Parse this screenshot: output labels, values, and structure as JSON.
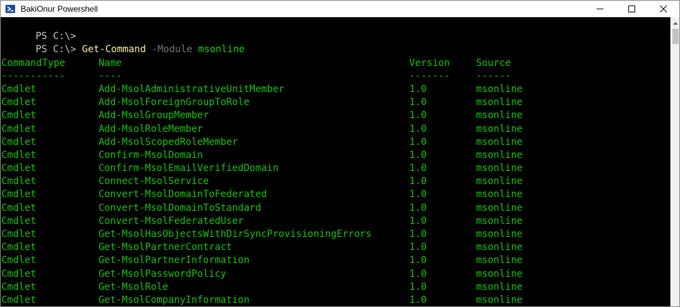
{
  "window": {
    "title": "BakiOnur Powershell"
  },
  "prompt_lines": [
    {
      "prompt": "PS C:\\>",
      "command": "",
      "param": "",
      "arg": ""
    },
    {
      "prompt": "PS C:\\>",
      "command": "Get-Command",
      "param": "-Module",
      "arg": "msonline"
    }
  ],
  "table": {
    "headers": [
      "CommandType",
      "Name",
      "Version",
      "Source"
    ],
    "separators": [
      "-----------",
      "----",
      "-------",
      "------"
    ],
    "rows": [
      [
        "Cmdlet",
        "Add-MsolAdministrativeUnitMember",
        "1.0",
        "msonline"
      ],
      [
        "Cmdlet",
        "Add-MsolForeignGroupToRole",
        "1.0",
        "msonline"
      ],
      [
        "Cmdlet",
        "Add-MsolGroupMember",
        "1.0",
        "msonline"
      ],
      [
        "Cmdlet",
        "Add-MsolRoleMember",
        "1.0",
        "msonline"
      ],
      [
        "Cmdlet",
        "Add-MsolScopedRoleMember",
        "1.0",
        "msonline"
      ],
      [
        "Cmdlet",
        "Confirm-MsolDomain",
        "1.0",
        "msonline"
      ],
      [
        "Cmdlet",
        "Confirm-MsolEmailVerifiedDomain",
        "1.0",
        "msonline"
      ],
      [
        "Cmdlet",
        "Connect-MsolService",
        "1.0",
        "msonline"
      ],
      [
        "Cmdlet",
        "Convert-MsolDomainToFederated",
        "1.0",
        "msonline"
      ],
      [
        "Cmdlet",
        "Convert-MsolDomainToStandard",
        "1.0",
        "msonline"
      ],
      [
        "Cmdlet",
        "Convert-MsolFederatedUser",
        "1.0",
        "msonline"
      ],
      [
        "Cmdlet",
        "Get-MsolHasObjectsWithDirSyncProvisioningErrors",
        "1.0",
        "msonline"
      ],
      [
        "Cmdlet",
        "Get-MsolPartnerContract",
        "1.0",
        "msonline"
      ],
      [
        "Cmdlet",
        "Get-MsolPartnerInformation",
        "1.0",
        "msonline"
      ],
      [
        "Cmdlet",
        "Get-MsolPasswordPolicy",
        "1.0",
        "msonline"
      ],
      [
        "Cmdlet",
        "Get-MsolRole",
        "1.0",
        "msonline"
      ],
      [
        "Cmdlet",
        "Get-MsolCompanyInformation",
        "1.0",
        "msonline"
      ]
    ]
  },
  "icons": {
    "app": "powershell-icon",
    "minimize": "minimize-icon",
    "maximize": "maximize-icon",
    "close": "close-icon"
  },
  "colors": {
    "background": "#000000",
    "text": "#cccccc",
    "command": "#f9f1a5",
    "parameter": "#767676",
    "output": "#16c60c"
  }
}
